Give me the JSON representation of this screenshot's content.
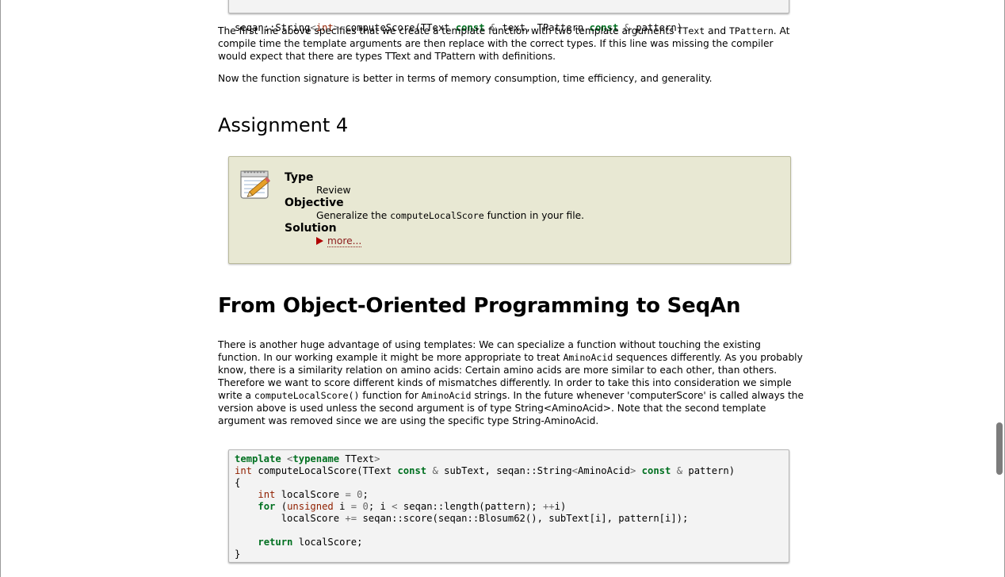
{
  "code_top": {
    "line": [
      {
        "t": "seqan::String",
        "c": ""
      },
      {
        "t": "<",
        "c": "op"
      },
      {
        "t": "int",
        "c": "kt"
      },
      {
        "t": ">",
        "c": "op"
      },
      {
        "t": " computeScore(TText ",
        "c": ""
      },
      {
        "t": "const",
        "c": "kw"
      },
      {
        "t": " ",
        "c": ""
      },
      {
        "t": "&",
        "c": "op"
      },
      {
        "t": " text, TPattern ",
        "c": ""
      },
      {
        "t": "const",
        "c": "kw"
      },
      {
        "t": " ",
        "c": ""
      },
      {
        "t": "&",
        "c": "op"
      },
      {
        "t": " pattern)",
        "c": ""
      }
    ]
  },
  "para1": {
    "t1": "The first line above specifies that we create a template function with two template arguments ",
    "code1": "TText",
    "t2": " and ",
    "code2": "TPattern",
    "t3": ". At compile time the template arguments are then replace with the correct types. If this line was missing the compiler would expect that there are types TText and TPattern with definitions."
  },
  "para2": "Now the function signature is better in terms of memory consumption, time efficiency, and generality.",
  "assignment_heading": "Assignment 4",
  "assignment": {
    "type_label": "Type",
    "type_value": "Review",
    "objective_label": "Objective",
    "objective_pre": "Generalize the ",
    "objective_code": "computeLocalScore",
    "objective_post": " function in your file.",
    "solution_label": "Solution",
    "more_label": "more..."
  },
  "section_heading": "From Object-Oriented Programming to SeqAn",
  "para3": {
    "t1": "There is another huge advantage of using templates: We can specialize a function without touching the existing function. In our working example it might be more appropriate to treat ",
    "code1": "AminoAcid",
    "t2": " sequences differently. As you probably know, there is a similarity relation on amino acids: Certain amino acids are more similar to each other, than others. Therefore we want to score different kinds of mismatches differently. In order to take this into consideration we simple write a ",
    "code2": "computeLocalScore()",
    "t3": " function for ",
    "code3": "AminoAcid",
    "t4": " strings. In the future whenever 'computerScore' is called always the version above is used unless the second argument is of type String<AminoAcid>. Note that the second template argument was removed since we are using the specific type String-AminoAcid."
  },
  "code_bottom": [
    [
      {
        "t": "template",
        "c": "kw"
      },
      {
        "t": " ",
        "c": ""
      },
      {
        "t": "<",
        "c": "op"
      },
      {
        "t": "typename",
        "c": "kw"
      },
      {
        "t": " TText",
        "c": ""
      },
      {
        "t": ">",
        "c": "op"
      }
    ],
    [
      {
        "t": "int",
        "c": "kt"
      },
      {
        "t": " computeLocalScore(TText ",
        "c": ""
      },
      {
        "t": "const",
        "c": "kw"
      },
      {
        "t": " ",
        "c": ""
      },
      {
        "t": "&",
        "c": "op"
      },
      {
        "t": " subText, seqan::String",
        "c": ""
      },
      {
        "t": "<",
        "c": "op"
      },
      {
        "t": "AminoAcid",
        "c": ""
      },
      {
        "t": ">",
        "c": "op"
      },
      {
        "t": " ",
        "c": ""
      },
      {
        "t": "const",
        "c": "kw"
      },
      {
        "t": " ",
        "c": ""
      },
      {
        "t": "&",
        "c": "op"
      },
      {
        "t": " pattern)",
        "c": ""
      }
    ],
    [
      {
        "t": "{",
        "c": ""
      }
    ],
    [
      {
        "t": "    ",
        "c": ""
      },
      {
        "t": "int",
        "c": "kt"
      },
      {
        "t": " localScore ",
        "c": ""
      },
      {
        "t": "=",
        "c": "op"
      },
      {
        "t": " ",
        "c": ""
      },
      {
        "t": "0",
        "c": "op"
      },
      {
        "t": ";",
        "c": ""
      }
    ],
    [
      {
        "t": "    ",
        "c": ""
      },
      {
        "t": "for",
        "c": "kw"
      },
      {
        "t": " (",
        "c": ""
      },
      {
        "t": "unsigned",
        "c": "kt"
      },
      {
        "t": " i ",
        "c": ""
      },
      {
        "t": "=",
        "c": "op"
      },
      {
        "t": " ",
        "c": ""
      },
      {
        "t": "0",
        "c": "op"
      },
      {
        "t": "; i ",
        "c": ""
      },
      {
        "t": "<",
        "c": "op"
      },
      {
        "t": " seqan::length(pattern); ",
        "c": ""
      },
      {
        "t": "++",
        "c": "op"
      },
      {
        "t": "i)",
        "c": ""
      }
    ],
    [
      {
        "t": "        localScore ",
        "c": ""
      },
      {
        "t": "+=",
        "c": "op"
      },
      {
        "t": " seqan::score(seqan::Blosum62(), subText[i], pattern[i]);",
        "c": ""
      }
    ],
    [
      {
        "t": "",
        "c": ""
      }
    ],
    [
      {
        "t": "    ",
        "c": ""
      },
      {
        "t": "return",
        "c": "kw"
      },
      {
        "t": " localScore;",
        "c": ""
      }
    ],
    [
      {
        "t": "}",
        "c": ""
      }
    ]
  ],
  "colors": {
    "keyword": "#007020",
    "type": "#902000",
    "operator": "#666666",
    "assignment_bg": "#e8e8d3",
    "code_bg": "#f3f3f3",
    "more_link": "#8b1a1a"
  },
  "icons": {
    "assignment": "notepad-pencil-icon",
    "solution_toggle": "triangle-right-icon"
  }
}
